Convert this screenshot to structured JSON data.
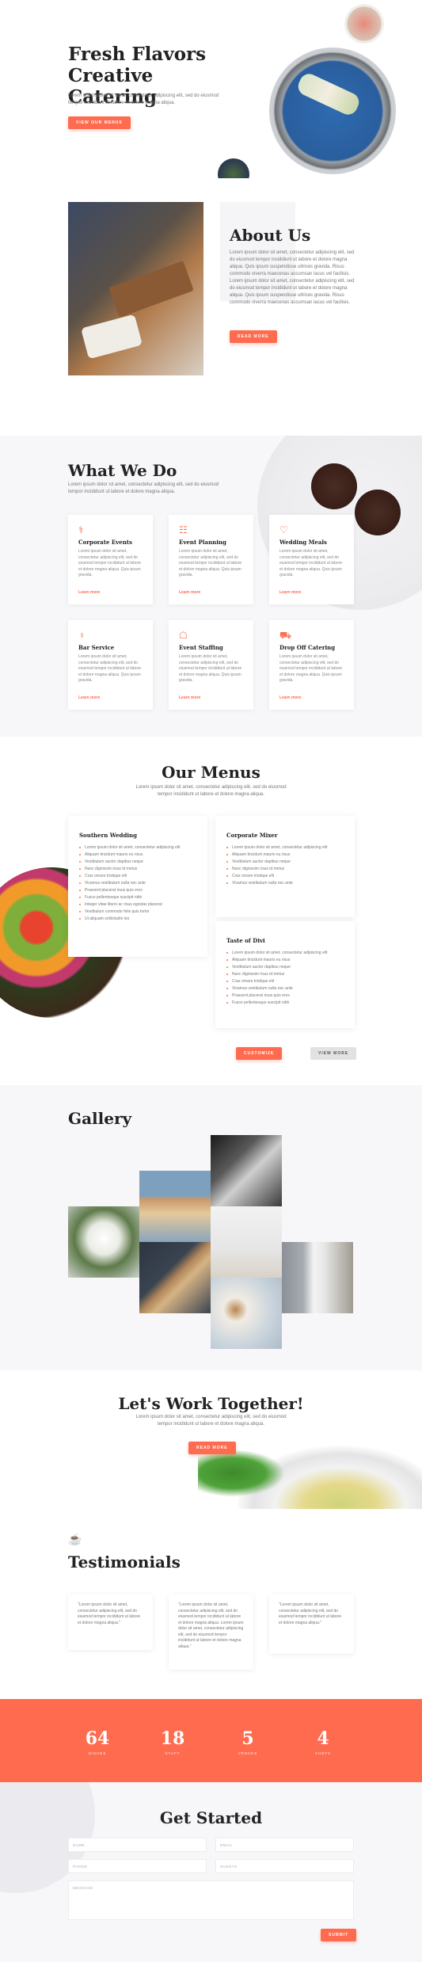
{
  "hero": {
    "title": "Fresh Flavors Creative Catering",
    "subtitle": "Lorem ipsum dolor sit amet, consectetur adipiscing elit, sed do eiusmod tempor incididunt ut labore et dolore magna aliqua.",
    "button": "VIEW OUR MENUS"
  },
  "about": {
    "title": "About Us",
    "body": "Lorem ipsum dolor sit amet, consectetur adipiscing elit, sed do eiusmod tempor incididunt ut labore et dolore magna aliqua. Quis ipsum suspendisse ultrices gravida. Risus commodo viverra maecenas accumsan lacus vel facilisis. Lorem ipsum dolor sit amet, consectetur adipiscing elit, sed do eiusmod tempor incididunt ut labore et dolore magna aliqua. Quis ipsum suspendisse ultrices gravida. Risus commodo viverra maecenas accumsan lacus vel facilisis.",
    "button": "READ MORE"
  },
  "services": {
    "title": "What We Do",
    "subtitle": "Lorem ipsum dolor sit amet, consectetur adipiscing elit, sed do eiusmod tempor incididunt ut labore et dolore magna aliqua.",
    "card_text": "Lorem ipsum dolor sit amet, consectetur adipiscing elit, sed do eiusmod tempor incididunt ut labore et dolore magna aliqua. Quis ipsum gravida.",
    "link": "Learn more",
    "cards": [
      {
        "title": "Corporate Events",
        "icon": "briefcase-icon",
        "glyph": "⚕"
      },
      {
        "title": "Event Planning",
        "icon": "calendar-icon",
        "glyph": "☷"
      },
      {
        "title": "Wedding Meals",
        "icon": "heart-icon",
        "glyph": "♡"
      },
      {
        "title": "Bar Service",
        "icon": "cocktail-icon",
        "glyph": "♀"
      },
      {
        "title": "Event Staffing",
        "icon": "building-icon",
        "glyph": "☖"
      },
      {
        "title": "Drop Off Catering",
        "icon": "truck-icon",
        "glyph": "⛟"
      }
    ]
  },
  "menus": {
    "title": "Our Menus",
    "subtitle": "Lorem ipsum dolor sit amet, consectetur adipiscing elit, sed do eiusmod tempor incididunt ut labore et dolore magna aliqua.",
    "southern": {
      "title": "Southern Wedding",
      "items": [
        "Lorem ipsum dolor sit amet, consectetur adipiscing elit",
        "Aliquam tincidunt mauris eu risus",
        "Vestibulum auctor dapibus neque",
        "Nunc dignissim risus id metus",
        "Cras ornare tristique elit",
        "Vivamus vestibulum nulla nec ante",
        "Praesent placerat risus quis eros",
        "Fusce pellentesque suscipit nibh",
        "Integer vitae libero ac risus egestas placerat",
        "Vestibulum commodo felis quis tortor",
        "Ut aliquam sollicitudin leo"
      ]
    },
    "corporate": {
      "title": "Corporate Mixer",
      "items": [
        "Lorem ipsum dolor sit amet, consectetur adipiscing elit",
        "Aliquam tincidunt mauris eu risus",
        "Vestibulum auctor dapibus neque",
        "Nunc dignissim risus id metus",
        "Cras ornare tristique elit",
        "Vivamus vestibulum nulla nec ante"
      ]
    },
    "divi": {
      "title": "Taste of Divi",
      "items": [
        "Lorem ipsum dolor sit amet, consectetur adipiscing elit",
        "Aliquam tincidunt mauris eu risus",
        "Vestibulum auctor dapibus neque",
        "Nunc dignissim risus id metus",
        "Cras ornare tristique elit",
        "Vivamus vestibulum nulla nec ante",
        "Praesent placerat risus quis eros",
        "Fusce pellentesque suscipit nibh"
      ]
    },
    "btn_customize": "CUSTOMIZE",
    "btn_view_more": "VIEW MORE"
  },
  "gallery": {
    "title": "Gallery"
  },
  "work": {
    "title": "Let's Work Together!",
    "subtitle": "Lorem ipsum dolor sit amet, consectetur adipiscing elit, sed do eiusmod tempor incididunt ut labore et dolore magna aliqua.",
    "button": "READ MORE"
  },
  "testimonials": {
    "title": "Testimonials",
    "quotes": [
      "\"Lorem ipsum dolor sit amet, consectetur adipiscing elit, sed do eiusmod tempor incididunt ut labore et dolore magna aliqua.\"",
      "\"Lorem ipsum dolor sit amet, consectetur adipiscing elit, sed do eiusmod tempor incididunt ut labore et dolore magna aliqua. Lorem ipsum dolor sit amet, consectetur adipiscing elit, sed do eiusmod tempor incididunt ut labore et dolore magna aliqua.\"",
      "\"Lorem ipsum dolor sit amet, consectetur adipiscing elit, sed do eiusmod tempor incididunt ut labore et dolore magna aliqua.\""
    ]
  },
  "stats": [
    {
      "number": "64",
      "label": "DISHES"
    },
    {
      "number": "18",
      "label": "STAFF"
    },
    {
      "number": "5",
      "label": "VENUES"
    },
    {
      "number": "4",
      "label": "CHEFS"
    }
  ],
  "contact": {
    "title": "Get Started",
    "name": "NAME",
    "email": "EMAIL",
    "phone": "PHONE",
    "guests": "GUESTS",
    "message": "MESSAGE",
    "submit": "SUBMIT"
  },
  "colors": {
    "accent": "#ff6b4f",
    "light_bg": "#f7f7f9",
    "heading": "#222222"
  }
}
